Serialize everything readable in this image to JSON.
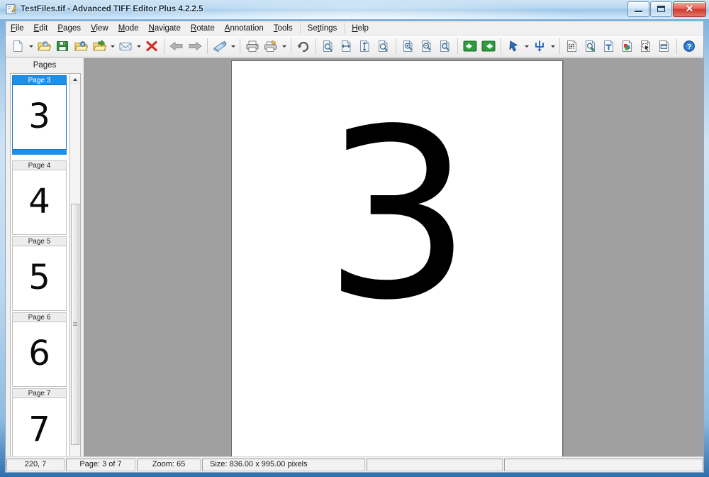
{
  "window": {
    "title": "TestFiles.tif - Advanced TIFF Editor Plus 4.2.2.5",
    "app_icon": "tiff-editor-icon",
    "minimize_label": "Minimize",
    "maximize_label": "Maximize",
    "close_label": "✕"
  },
  "menu": {
    "items": [
      {
        "label": "File",
        "accel": "F"
      },
      {
        "label": "Edit",
        "accel": "E"
      },
      {
        "label": "Pages",
        "accel": "P"
      },
      {
        "label": "View",
        "accel": "V"
      },
      {
        "label": "Mode",
        "accel": "M"
      },
      {
        "label": "Navigate",
        "accel": "N"
      },
      {
        "label": "Rotate",
        "accel": "R"
      },
      {
        "label": "Annotation",
        "accel": "A"
      },
      {
        "label": "Tools",
        "accel": "T"
      }
    ],
    "items2": [
      {
        "label": "Settings",
        "accel": "t"
      }
    ],
    "items3": [
      {
        "label": "Help",
        "accel": "H"
      }
    ]
  },
  "toolbar": {
    "groups": [
      {
        "buttons": [
          {
            "icon": "new-document-icon",
            "title": "New",
            "dropdown": true
          },
          {
            "icon": "open-folder-icon",
            "title": "Open",
            "dropdown": false
          },
          {
            "icon": "save-floppy-icon",
            "title": "Save",
            "dropdown": false
          },
          {
            "icon": "save-as-icon",
            "title": "Save As",
            "dropdown": false
          },
          {
            "icon": "export-icon",
            "title": "Export",
            "dropdown": true
          },
          {
            "icon": "email-envelope-icon",
            "title": "Send by E-mail",
            "dropdown": true
          },
          {
            "icon": "close-red-x-icon",
            "title": "Close",
            "dropdown": false
          }
        ]
      },
      {
        "buttons": [
          {
            "icon": "arrow-left-gray-icon",
            "title": "Previous File",
            "dropdown": false
          },
          {
            "icon": "arrow-right-gray-icon",
            "title": "Next File",
            "dropdown": false
          }
        ]
      },
      {
        "buttons": [
          {
            "icon": "scanner-icon",
            "title": "Acquire",
            "dropdown": true
          }
        ]
      },
      {
        "buttons": [
          {
            "icon": "print-icon",
            "title": "Print",
            "dropdown": false
          },
          {
            "icon": "print-setup-icon",
            "title": "Print Setup",
            "dropdown": true
          }
        ]
      },
      {
        "buttons": [
          {
            "icon": "undo-icon",
            "title": "Undo",
            "dropdown": false
          }
        ]
      },
      {
        "buttons": [
          {
            "icon": "zoom-fit-page-icon",
            "title": "Fit Page",
            "dropdown": false
          },
          {
            "icon": "zoom-fit-width-icon",
            "title": "Fit Width",
            "dropdown": false
          },
          {
            "icon": "zoom-fit-height-icon",
            "title": "Fit Height",
            "dropdown": false
          },
          {
            "icon": "zoom-actual-size-icon",
            "title": "Actual Size",
            "dropdown": false
          }
        ]
      },
      {
        "buttons": [
          {
            "icon": "zoom-in-icon",
            "title": "Zoom In",
            "dropdown": false
          },
          {
            "icon": "zoom-out-icon",
            "title": "Zoom Out",
            "dropdown": false
          },
          {
            "icon": "zoom-select-icon",
            "title": "Zoom Selection",
            "dropdown": false
          }
        ]
      },
      {
        "buttons": [
          {
            "icon": "page-previous-green-icon",
            "title": "Previous Page",
            "dropdown": false
          },
          {
            "icon": "page-next-green-icon",
            "title": "Next Page",
            "dropdown": false
          }
        ]
      },
      {
        "buttons": [
          {
            "icon": "pointer-blue-icon",
            "title": "Select Tool",
            "dropdown": true
          },
          {
            "icon": "split-blue-icon",
            "title": "Split",
            "dropdown": true
          }
        ]
      },
      {
        "buttons": [
          {
            "icon": "ocr-icon",
            "title": "OCR",
            "dropdown": false
          },
          {
            "icon": "inspect-page-icon",
            "title": "Inspect",
            "dropdown": false
          },
          {
            "icon": "text-annotation-icon",
            "title": "Text Annotation",
            "dropdown": false
          },
          {
            "icon": "color-page-icon",
            "title": "Color Mode",
            "dropdown": false
          },
          {
            "icon": "select-region-icon",
            "title": "Select Region",
            "dropdown": false
          },
          {
            "icon": "page-properties-icon",
            "title": "Page Properties",
            "dropdown": false
          }
        ]
      },
      {
        "buttons": [
          {
            "icon": "help-question-icon",
            "title": "Help",
            "dropdown": false
          }
        ]
      }
    ]
  },
  "pages_panel": {
    "header": "Pages",
    "thumbnails": [
      {
        "label": "Page 3",
        "number": "3",
        "selected": true
      },
      {
        "label": "Page 4",
        "number": "4",
        "selected": false
      },
      {
        "label": "Page 5",
        "number": "5",
        "selected": false
      },
      {
        "label": "Page 6",
        "number": "6",
        "selected": false
      },
      {
        "label": "Page 7",
        "number": "7",
        "selected": false
      }
    ]
  },
  "document": {
    "page_number": "3",
    "background_color": "#a0a0a0",
    "page_color": "#ffffff"
  },
  "status_bar": {
    "coords": "220, 7",
    "page": "Page: 3 of 7",
    "zoom": "Zoom: 65",
    "size": "Size: 836.00 x 995.00 pixels"
  }
}
